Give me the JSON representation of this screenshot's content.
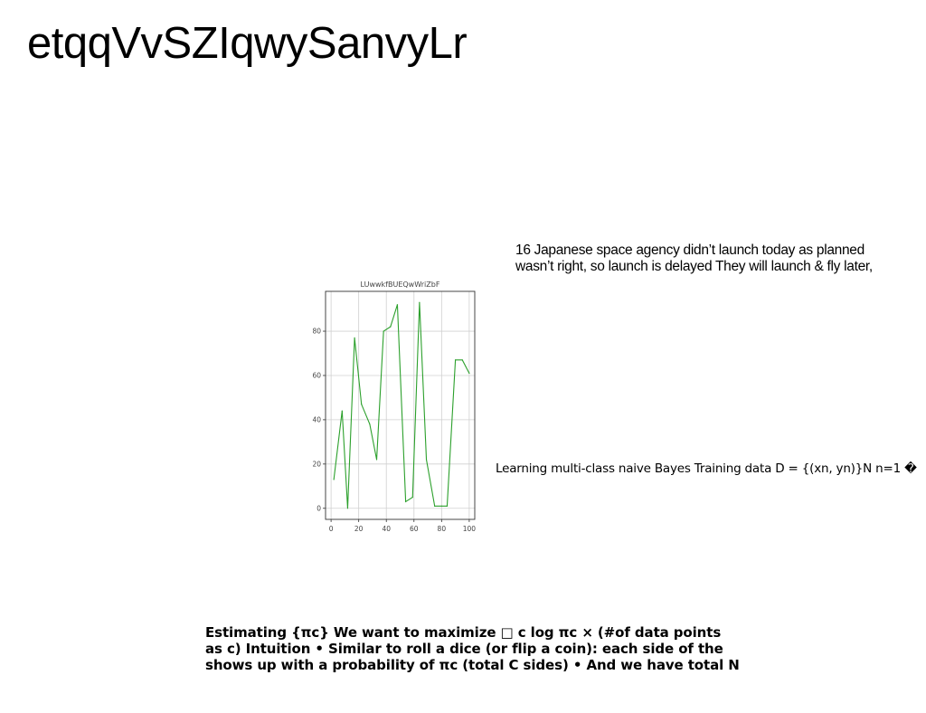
{
  "page": {
    "title": "etqqVvSZIqwySanvyLr",
    "note_lines": [
      "16 Japanese space agency didn’t launch today as planned",
      "wasn’t right, so launch is delayed They will launch & fly later,"
    ],
    "caption": "Learning multi-class naive Bayes Training data D = {(xn, yn)}N n=1 �",
    "footer_lines": [
      "Estimating {πc} We want to maximize □ c log πc × (#of data points",
      "as c) Intuition • Similar to roll a dice (or flip a coin): each side of the",
      "shows up with a probability of πc (total C sides) • And we have total N"
    ]
  },
  "chart_data": {
    "type": "line",
    "title": "LUwwkfBUEQwWriZbF",
    "xlabel": "",
    "ylabel": "",
    "xlim": [
      -4,
      104
    ],
    "ylim": [
      -5,
      98
    ],
    "xticks": [
      0,
      20,
      40,
      60,
      80,
      100
    ],
    "yticks": [
      0,
      20,
      40,
      60,
      80
    ],
    "grid": true,
    "series": [
      {
        "color": "#2ca02c",
        "x": [
          2,
          8,
          12,
          17,
          22,
          28,
          33,
          38,
          43,
          48,
          54,
          59,
          64,
          69,
          75,
          80,
          84,
          90,
          95,
          100
        ],
        "y": [
          13,
          44,
          0,
          77,
          47,
          38,
          22,
          80,
          82,
          92,
          3,
          5,
          93,
          22,
          1,
          1,
          1,
          67,
          67,
          61
        ]
      }
    ]
  }
}
